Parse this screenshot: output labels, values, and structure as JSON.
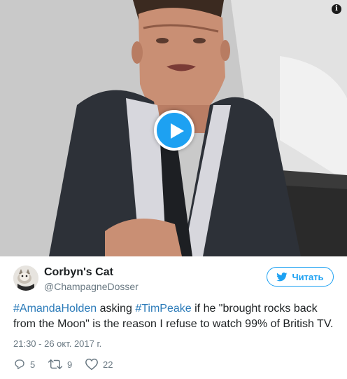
{
  "media": {
    "info_icon": "info-icon",
    "play_icon": "play-icon"
  },
  "author": {
    "name": "Corbyn's Cat",
    "handle": "@ChampagneDosser",
    "avatar_icon": "cat-avatar"
  },
  "follow": {
    "label": "Читать",
    "icon": "bird-icon"
  },
  "tweet": {
    "hashtag1": "#AmandaHolden",
    "text1": " asking ",
    "hashtag2": "#TimPeake",
    "text2": " if he \"brought rocks back from the Moon\" is the reason I refuse to watch 99% of British TV."
  },
  "timestamp": "21:30 - 26 окт. 2017 г.",
  "actions": {
    "replies": "5",
    "retweets": "9",
    "likes": "22"
  },
  "colors": {
    "accent": "#1da1f2",
    "hashtag": "#2b7bb9",
    "muted": "#697882"
  }
}
